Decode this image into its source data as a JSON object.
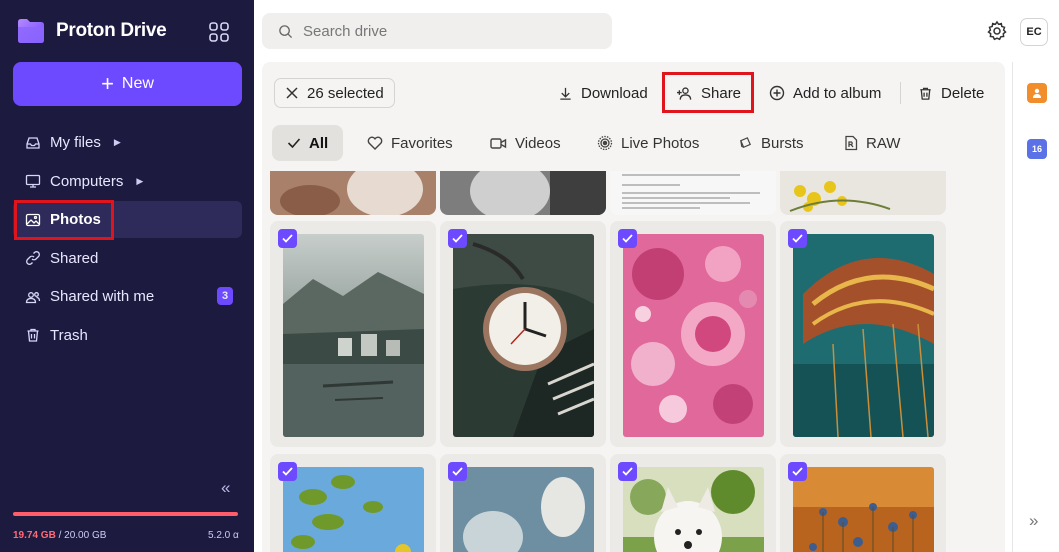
{
  "app": {
    "name": "Proton Drive",
    "new_label": "New",
    "storage_used": "19.74 GB",
    "storage_total": " / 20.00 GB",
    "storage_fraction": 0.987,
    "version": "5.2.0 α",
    "avatar": "EC"
  },
  "sidebar": {
    "items": [
      {
        "label": "My files",
        "icon": "inbox-icon",
        "caret": "▶"
      },
      {
        "label": "Computers",
        "icon": "monitor-icon",
        "caret": "▶"
      },
      {
        "label": "Photos",
        "icon": "image-icon",
        "active": true
      },
      {
        "label": "Shared",
        "icon": "link-icon"
      },
      {
        "label": "Shared with me",
        "icon": "users-icon",
        "badge": "3"
      },
      {
        "label": "Trash",
        "icon": "trash-icon"
      }
    ],
    "collapse": "«"
  },
  "search": {
    "placeholder": "Search drive"
  },
  "toolbar": {
    "selected_label": "26 selected",
    "download": "Download",
    "share": "Share",
    "add_to_album": "Add to album",
    "delete": "Delete"
  },
  "filters": [
    "All",
    "Favorites",
    "Videos",
    "Live Photos",
    "Bursts",
    "RAW"
  ],
  "rail": {
    "calendar_day": "16",
    "collapse": "»"
  },
  "colors": {
    "accent": "#6d4aff",
    "sidebar_bg": "#1c1a3f",
    "highlight": "#e0141d",
    "storage_warn": "#ff5d6a"
  }
}
